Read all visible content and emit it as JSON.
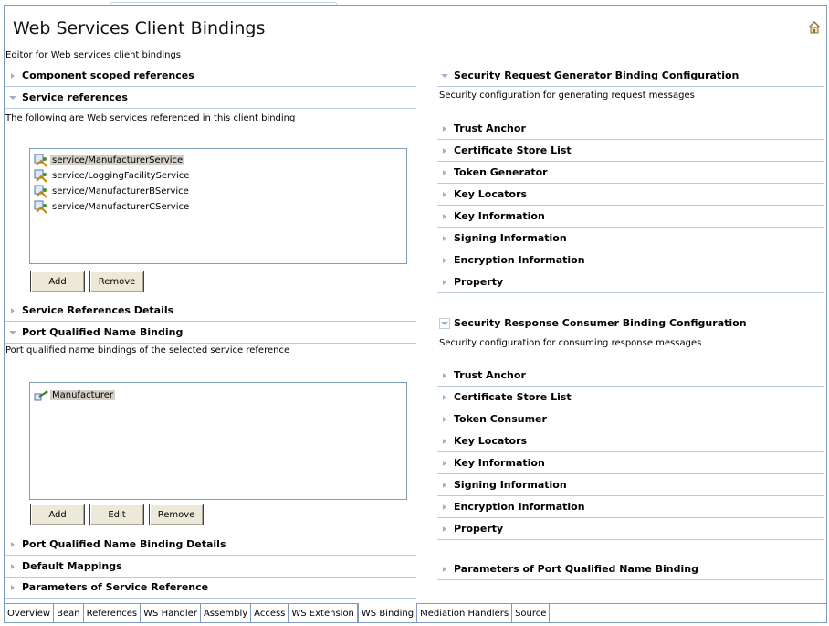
{
  "editor": {
    "title": "Web Services Client Bindings",
    "description": "Editor for Web services client bindings"
  },
  "left": {
    "component_scoped": "Component scoped references",
    "service_refs": {
      "title": "Service references",
      "description": "The following are Web services referenced in this client binding",
      "items": [
        "service/ManufacturerService",
        "service/LoggingFacilityService",
        "service/ManufacturerBService",
        "service/ManufacturerCService"
      ],
      "selected_index": 0,
      "add_label": "Add",
      "remove_label": "Remove"
    },
    "service_refs_details": "Service References Details",
    "port_binding": {
      "title": "Port Qualified Name Binding",
      "description": "Port qualified name bindings of the selected service reference",
      "items": [
        "Manufacturer"
      ],
      "add_label": "Add",
      "edit_label": "Edit",
      "remove_label": "Remove"
    },
    "port_binding_details": "Port Qualified Name Binding Details",
    "default_mappings": "Default Mappings",
    "params_service_ref": "Parameters of Service Reference"
  },
  "right": {
    "generator": {
      "title": "Security Request Generator Binding Configuration",
      "description": "Security configuration for generating request messages",
      "items": [
        "Trust Anchor",
        "Certificate Store List",
        "Token Generator",
        "Key Locators",
        "Key Information",
        "Signing Information",
        "Encryption Information",
        "Property"
      ]
    },
    "consumer": {
      "title": "Security Response Consumer Binding Configuration",
      "description": "Security configuration for consuming response messages",
      "items": [
        "Trust Anchor",
        "Certificate Store List",
        "Token Consumer",
        "Key Locators",
        "Key Information",
        "Signing Information",
        "Encryption Information",
        "Property"
      ]
    },
    "params_port": "Parameters of Port Qualified Name Binding"
  },
  "tabs": [
    "Overview",
    "Bean",
    "References",
    "WS Handler",
    "Assembly",
    "Access",
    "WS Extension",
    "WS Binding",
    "Mediation Handlers",
    "Source"
  ],
  "active_tab": "WS Binding",
  "colors": {
    "section_line": "#b9c8dc",
    "selection": "#d4d0c8",
    "border": "#7f9db9",
    "button_face": "#ece9d8"
  },
  "icons": {
    "home": "home-icon",
    "service_ref": "service-reference-icon",
    "port": "port-binding-icon",
    "collapsed": "twistie-collapsed-icon",
    "expanded": "twistie-expanded-icon"
  }
}
